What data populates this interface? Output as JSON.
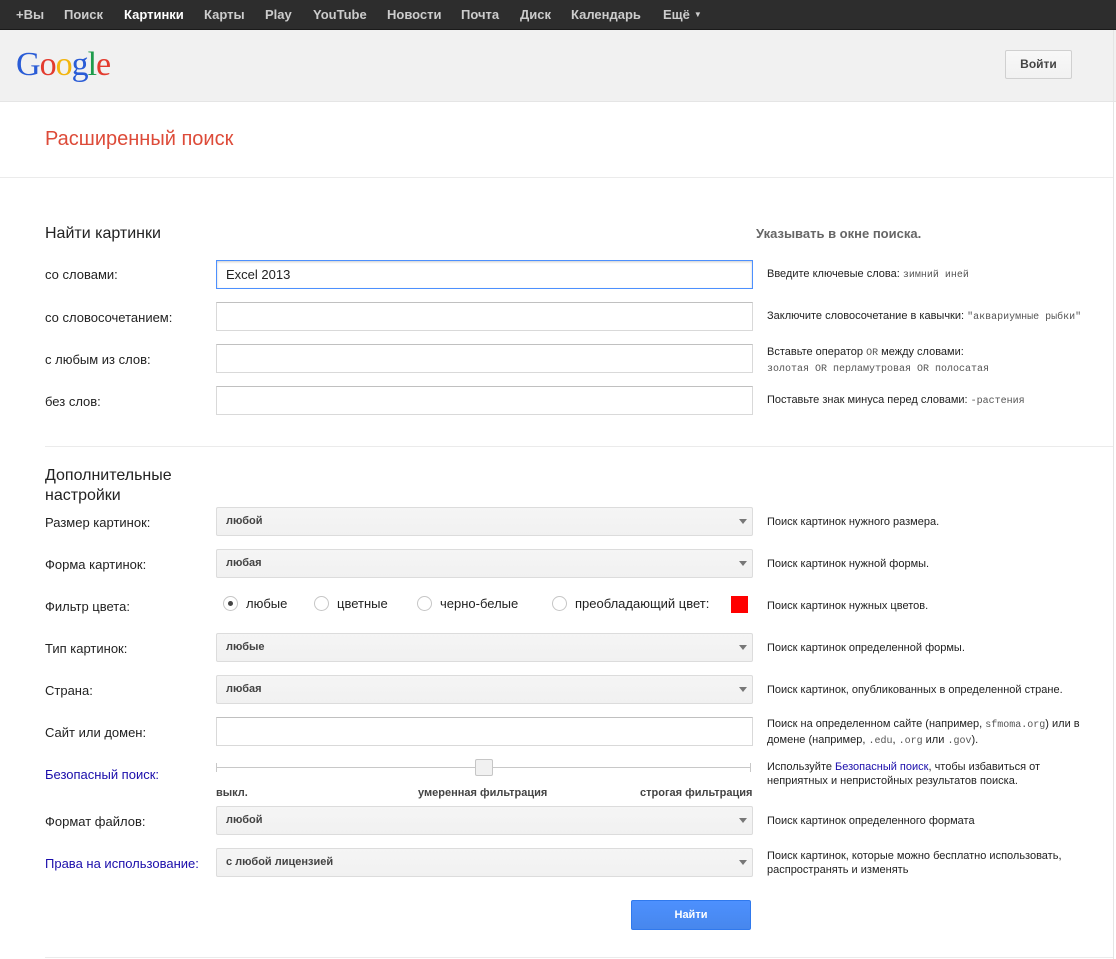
{
  "topbar": {
    "items": [
      {
        "label": "+Вы"
      },
      {
        "label": "Поиск"
      },
      {
        "label": "Картинки",
        "active": true
      },
      {
        "label": "Карты"
      },
      {
        "label": "Play"
      },
      {
        "label": "YouTube"
      },
      {
        "label": "Новости"
      },
      {
        "label": "Почта"
      },
      {
        "label": "Диск"
      },
      {
        "label": "Календарь"
      },
      {
        "label": "Ещё"
      }
    ]
  },
  "header": {
    "logo": "Google",
    "signin_label": "Войти"
  },
  "page": {
    "title": "Расширенный поиск"
  },
  "find_section": {
    "title": "Найти картинки",
    "side_heading": "Указывать в окне поиска.",
    "rows": [
      {
        "label": "со словами:",
        "value": "Excel 2013",
        "hint_text": "Введите ключевые слова: ",
        "hint_code": "зимний иней"
      },
      {
        "label": "со словосочетанием:",
        "value": "",
        "hint_text": "Заключите словосочетание в кавычки: ",
        "hint_code": "\"аквариумные рыбки\""
      },
      {
        "label": "с любым из слов:",
        "value": "",
        "hint_line1_text": "Вставьте оператор ",
        "hint_line1_code": "OR",
        "hint_line1_tail": " между словами:",
        "hint_line2_code": "золотая OR перламутровая OR полосатая"
      },
      {
        "label": "без слов:",
        "value": "",
        "hint_text": "Поставьте знак минуса перед словами: ",
        "hint_code": "-растения"
      }
    ]
  },
  "more_section": {
    "title_line1": "Дополнительные",
    "title_line2": "настройки",
    "size": {
      "label": "Размер картинок:",
      "value": "любой",
      "hint": "Поиск картинок нужного размера."
    },
    "shape": {
      "label": "Форма картинок:",
      "value": "любая",
      "hint": "Поиск картинок нужной формы."
    },
    "color": {
      "label": "Фильтр цвета:",
      "options": [
        "любые",
        "цветные",
        "черно-белые",
        "преобладающий цвет:"
      ],
      "selected": "любые",
      "swatch_color": "#ff0000",
      "hint": "Поиск картинок нужных цветов."
    },
    "type": {
      "label": "Тип картинок:",
      "value": "любые",
      "hint": "Поиск картинок определенной формы."
    },
    "region": {
      "label": "Страна:",
      "value": "любая",
      "hint": "Поиск картинок, опубликованных в определенной стране."
    },
    "site": {
      "label": "Сайт или домен:",
      "value": "",
      "hint_l1_a": "Поиск на определенном сайте (например, ",
      "hint_l1_code": "sfmoma.org",
      "hint_l1_b": ") или в",
      "hint_l2_a": "домене (например, ",
      "hint_l2_code1": ".edu",
      "hint_l2_sep1": ", ",
      "hint_l2_code2": ".org",
      "hint_l2_sep2": " или ",
      "hint_l2_code3": ".gov",
      "hint_l2_b": ")."
    },
    "safesearch": {
      "label": "Безопасный поиск:",
      "levels": [
        "выкл.",
        "умеренная фильтрация",
        "строгая фильтрация"
      ],
      "selected": "умеренная фильтрация",
      "hint_l1_a": "Используйте ",
      "hint_l1_link": "Безопасный поиск",
      "hint_l1_b": ", чтобы избавиться от",
      "hint_l2": "неприятных и непристойных результатов поиска."
    },
    "filetype": {
      "label": "Формат файлов:",
      "value": "любой",
      "hint": "Поиск картинок определенного формата"
    },
    "rights": {
      "label": "Права на использование:",
      "value": "с любой лицензией",
      "hint_l1": "Поиск картинок, которые можно бесплатно использовать,",
      "hint_l2": "распространять и изменять"
    },
    "submit_label": "Найти"
  },
  "colors": {
    "title_red": "#dd4b39",
    "link_blue": "#1a0dab",
    "button_blue": "#4d90fe",
    "topbar_bg": "#2d2d2d"
  }
}
